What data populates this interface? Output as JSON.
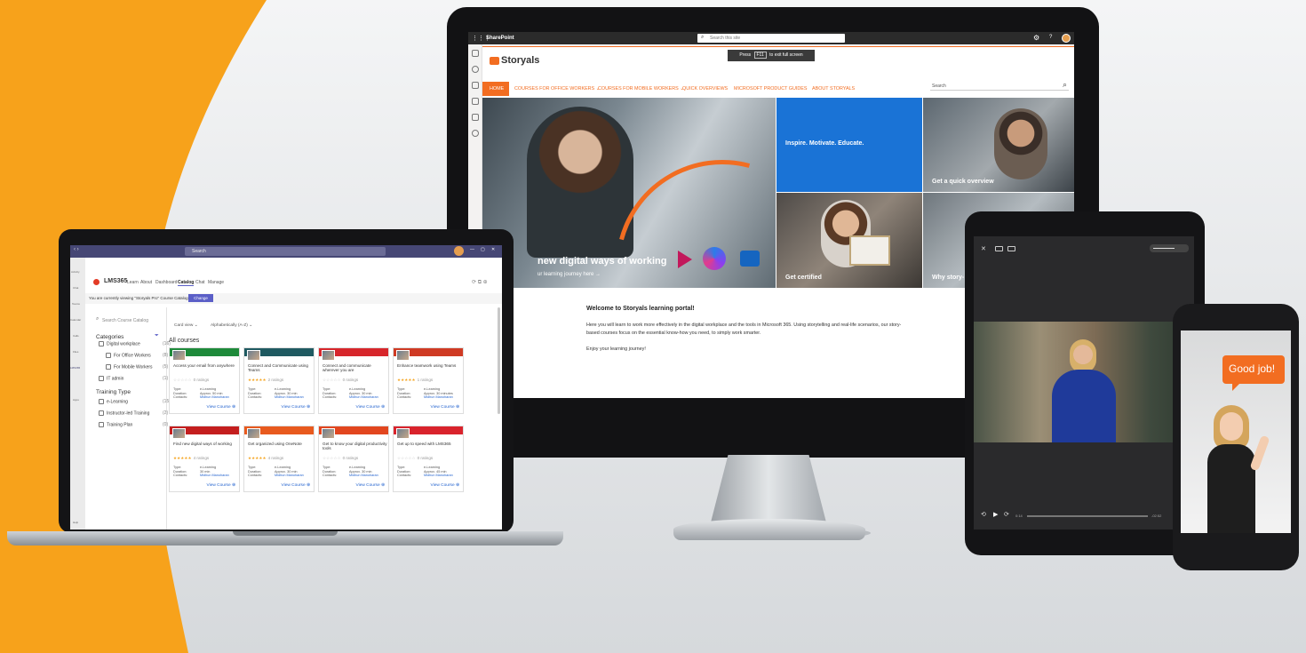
{
  "colors": {
    "accent_orange": "#f7a21b",
    "storyals_orange": "#f26d21",
    "sharepoint_blue": "#1a73d6",
    "teams_purple": "#5b5fc7",
    "link_blue": "#2564cf"
  },
  "monitor": {
    "suite_bar": {
      "app_name": "SharePoint",
      "search_placeholder": "Search this site",
      "help": "?",
      "settings_icon": "gear-icon",
      "waffle_icon": "waffle-icon"
    },
    "fullscreen_toast": {
      "pre": "Press",
      "key": "F11",
      "post": "to exit full screen"
    },
    "site": {
      "logo_text": "Storyals",
      "logo_icon": "play-icon",
      "menu": [
        "HOME",
        "COURSES FOR OFFICE WORKERS ⌄",
        "COURSES FOR MOBILE WORKERS ⌄",
        "QUICK OVERVIEWS",
        "MICROSOFT PRODUCT GUIDES",
        "ABOUT STORYALS"
      ],
      "search_placeholder": "Search"
    },
    "hero": {
      "headline": "new digital ways of working",
      "subline": "ur learning journey here →",
      "tiles": [
        "Inspire. Motivate. Educate.",
        "Get a quick overview",
        "Get certified",
        "Why story-"
      ]
    },
    "welcome": {
      "title": "Welcome to Storyals learning portal!",
      "line1": "Here you will learn to work more effectively in the digital workplace and the tools in Microsoft 365. Using storytelling and real-life scenarios, our story-",
      "line2": "based courses focus on the essential know-how you need, to simply work smarter.",
      "line3": "Enjoy your learning journey!"
    }
  },
  "laptop": {
    "titlebar": {
      "search_placeholder": "Search",
      "window_controls": [
        "—",
        "▢",
        "✕"
      ]
    },
    "app": {
      "name": "LMS365",
      "nav": [
        "Learn",
        "About",
        "Dashboard",
        "Catalog",
        "Chat",
        "Manage"
      ],
      "active_nav": "Catalog"
    },
    "catalog_banner": {
      "text": "You are currently viewing \"Storyals Pro\" Course Catalog",
      "button": "Change"
    },
    "sidebar": {
      "search_placeholder": "Search Course Catalog",
      "categories_title": "Categories",
      "categories": [
        {
          "label": "Digital workplace",
          "count": "(16)"
        },
        {
          "label": "For Office Workers",
          "count": "(8)"
        },
        {
          "label": "For Mobile Workers",
          "count": "(5)"
        },
        {
          "label": "IT admin",
          "count": "(1)"
        }
      ],
      "training_title": "Training Type",
      "training": [
        {
          "label": "e-Learning",
          "count": "(15)"
        },
        {
          "label": "Instructor-led Training",
          "count": "(2)"
        },
        {
          "label": "Training Plan",
          "count": "(0)"
        }
      ]
    },
    "toolbar": {
      "view": "Card view ⌄",
      "sort": "Alphabetically (A-Z) ⌄"
    },
    "list_title": "All courses",
    "meta_labels": [
      "Type:",
      "Duration:",
      "Contacts:"
    ],
    "view_label": "View Course",
    "courses": [
      {
        "title": "Access your email from anywhere",
        "stars": "☆☆☆☆☆",
        "ratings": "0 ratings",
        "type": "e-Learning",
        "duration": "Approx. 50 min",
        "contact": "Midhun Manoharan",
        "band": "#1e8a3a",
        "on": false
      },
      {
        "title": "Connect and Communicate using Teams",
        "stars": "★★★★★",
        "ratings": "2 ratings",
        "type": "e-Learning",
        "duration": "Approx. 30 min",
        "contact": "Midhun Manoharan",
        "band": "#1f5a61",
        "on": true
      },
      {
        "title": "Connect and communicate wherever you are",
        "stars": "☆☆☆☆☆",
        "ratings": "0 ratings",
        "type": "e-Learning",
        "duration": "Approx. 30 min",
        "contact": "Midhun Manoharan",
        "band": "#d7262b",
        "on": false
      },
      {
        "title": "Enhance teamwork using Teams",
        "stars": "★★★★★",
        "ratings": "1 ratings",
        "type": "e-Learning",
        "duration": "Approx. 30 minutes",
        "contact": "Midhun Manoharan",
        "band": "#cf3a24",
        "on": true
      },
      {
        "title": "Find new digital ways of working",
        "stars": "★★★★★",
        "ratings": "4 ratings",
        "type": "e-Learning",
        "duration": "30 min",
        "contact": "Midhun Manoharan",
        "band": "#c41e1e",
        "on": true
      },
      {
        "title": "Get organized using OneNote",
        "stars": "★★★★★",
        "ratings": "4 ratings",
        "type": "e-Learning",
        "duration": "Approx. 30 min",
        "contact": "Midhun Manoharan",
        "band": "#e85a1e",
        "on": true
      },
      {
        "title": "Get to know your digital productivity tools",
        "stars": "☆☆☆☆☆",
        "ratings": "0 ratings",
        "type": "e-Learning",
        "duration": "Approx. 30 min",
        "contact": "Midhun Manoharan",
        "band": "#e2461f",
        "on": false
      },
      {
        "title": "Get up to speed with LMS365",
        "stars": "☆☆☆☆☆",
        "ratings": "0 ratings",
        "type": "e-Learning",
        "duration": "Approx. 45 min",
        "contact": "Midhun Manoharan",
        "band": "#d9232c",
        "on": false
      }
    ],
    "left_rail": [
      "Activity",
      "Chat",
      "Teams",
      "Calendar",
      "Calls",
      "Files",
      "LMS365",
      "Apps"
    ],
    "help_label": "Help"
  },
  "tablet": {
    "close": "✕",
    "time_left": "0:14",
    "time_right": "-02:52"
  },
  "phone": {
    "bubble": "Good job!"
  }
}
